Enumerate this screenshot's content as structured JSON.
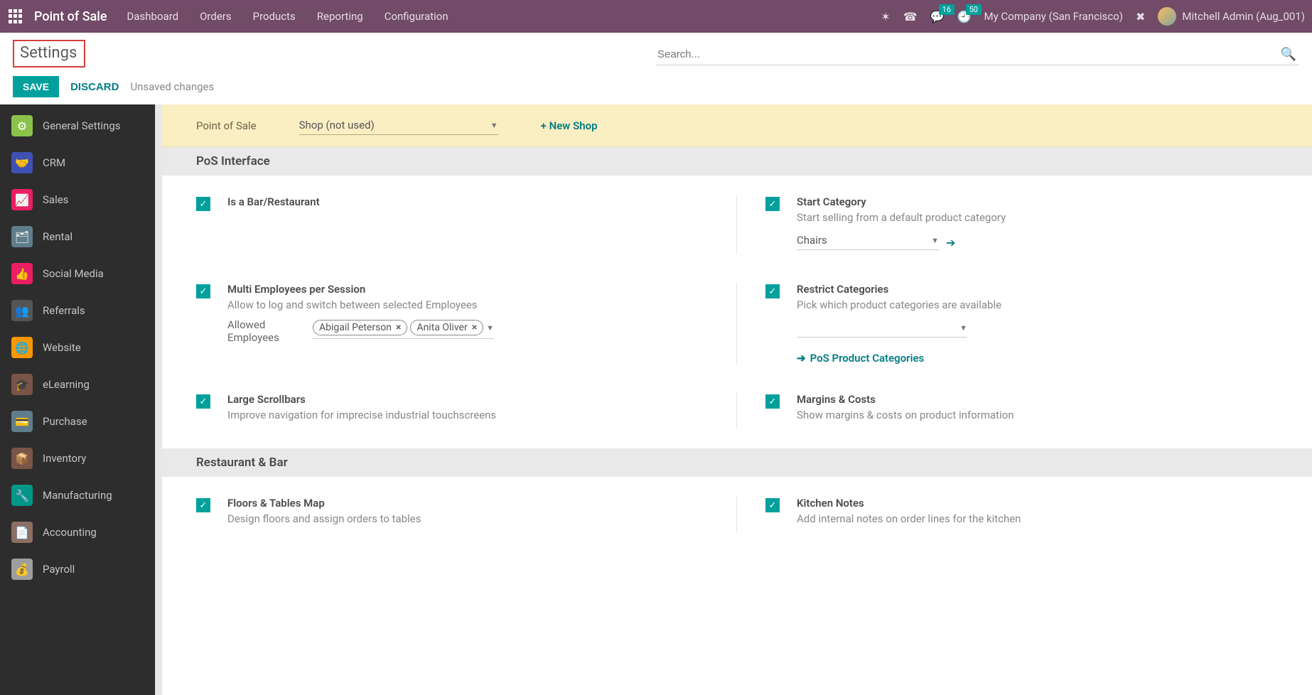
{
  "topnav": {
    "brand": "Point of Sale",
    "menu": [
      "Dashboard",
      "Orders",
      "Products",
      "Reporting",
      "Configuration"
    ],
    "msg_badge": "16",
    "clock_badge": "50",
    "company": "My Company (San Francisco)",
    "user": "Mitchell Admin (Aug_001)"
  },
  "cp": {
    "title": "Settings",
    "save": "SAVE",
    "discard": "DISCARD",
    "status": "Unsaved changes",
    "search_placeholder": "Search..."
  },
  "sidebar": [
    {
      "label": "General Settings",
      "color": "#8BC34A",
      "icon": "⚙"
    },
    {
      "label": "CRM",
      "color": "#3F51B5",
      "icon": "🤝"
    },
    {
      "label": "Sales",
      "color": "#E91E63",
      "icon": "📈"
    },
    {
      "label": "Rental",
      "color": "#607D8B",
      "icon": "🗂"
    },
    {
      "label": "Social Media",
      "color": "#E91E63",
      "icon": "👍"
    },
    {
      "label": "Referrals",
      "color": "#555",
      "icon": "👥"
    },
    {
      "label": "Website",
      "color": "#FF9800",
      "icon": "🌐"
    },
    {
      "label": "eLearning",
      "color": "#795548",
      "icon": "🎓"
    },
    {
      "label": "Purchase",
      "color": "#607D8B",
      "icon": "💳"
    },
    {
      "label": "Inventory",
      "color": "#795548",
      "icon": "📦"
    },
    {
      "label": "Manufacturing",
      "color": "#009688",
      "icon": "🔧"
    },
    {
      "label": "Accounting",
      "color": "#8D6E63",
      "icon": "📄"
    },
    {
      "label": "Payroll",
      "color": "#9E9E9E",
      "icon": "💰"
    }
  ],
  "posbar": {
    "label": "Point of Sale",
    "shop": "Shop (not used)",
    "newshop": "+ New Shop"
  },
  "sections": {
    "s1": "PoS Interface",
    "s2": "Restaurant & Bar"
  },
  "settings": {
    "bar": {
      "title": "Is a Bar/Restaurant"
    },
    "start": {
      "title": "Start Category",
      "desc": "Start selling from a default product category",
      "value": "Chairs"
    },
    "multi": {
      "title": "Multi Employees per Session",
      "desc": "Allow to log and switch between selected Employees",
      "field_label": "Allowed Employees",
      "tags": [
        "Abigail Peterson",
        "Anita Oliver"
      ]
    },
    "restrict": {
      "title": "Restrict Categories",
      "desc": "Pick which product categories are available",
      "link": "PoS Product Categories"
    },
    "scroll": {
      "title": "Large Scrollbars",
      "desc": "Improve navigation for imprecise industrial touchscreens"
    },
    "margins": {
      "title": "Margins & Costs",
      "desc": "Show margins & costs on product information"
    },
    "floors": {
      "title": "Floors & Tables Map",
      "desc": "Design floors and assign orders to tables"
    },
    "kitchen": {
      "title": "Kitchen Notes",
      "desc": "Add internal notes on order lines for the kitchen"
    }
  }
}
